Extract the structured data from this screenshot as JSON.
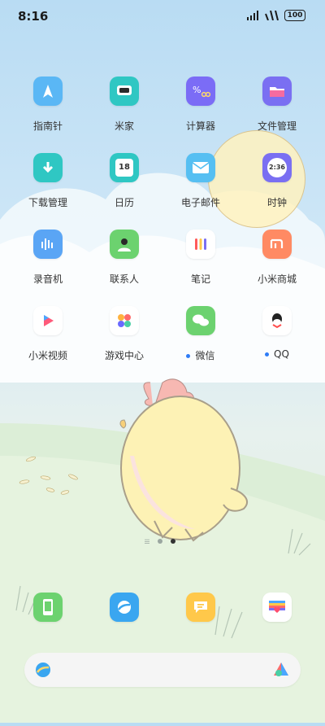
{
  "status": {
    "time": "8:16",
    "battery": "100"
  },
  "apps": [
    {
      "label": "指南针",
      "icon": "compass-icon",
      "color": "#5ab7f5"
    },
    {
      "label": "米家",
      "icon": "mijia-icon",
      "color": "#2fc7c3"
    },
    {
      "label": "计算器",
      "icon": "calculator-icon",
      "color": "#7b6cf6"
    },
    {
      "label": "文件管理",
      "icon": "folder-icon",
      "color": "#7a6ff2"
    },
    {
      "label": "下载管理",
      "icon": "download-icon",
      "color": "#2fc7c3"
    },
    {
      "label": "日历",
      "icon": "calendar-icon",
      "color": "#2fc7c3",
      "badge": "18"
    },
    {
      "label": "电子邮件",
      "icon": "mail-icon",
      "color": "#56bff2"
    },
    {
      "label": "时钟",
      "icon": "clock-icon",
      "color": "#7a6ff2",
      "badge": "2:36"
    },
    {
      "label": "录音机",
      "icon": "recorder-icon",
      "color": "#5aa5f5"
    },
    {
      "label": "联系人",
      "icon": "contacts-icon",
      "color": "#6cd26f"
    },
    {
      "label": "笔记",
      "icon": "notes-icon",
      "color": "#ffffff"
    },
    {
      "label": "小米商城",
      "icon": "mi-store-icon",
      "color": "#ff8a63"
    },
    {
      "label": "小米视频",
      "icon": "video-icon",
      "color": "#ffffff"
    },
    {
      "label": "游戏中心",
      "icon": "game-center-icon",
      "color": "#ffffff"
    },
    {
      "label": "微信",
      "icon": "wechat-icon",
      "color": "#6cd26f",
      "notify": true
    },
    {
      "label": "QQ",
      "icon": "qq-icon",
      "color": "#ffffff",
      "notify": true
    }
  ],
  "dock": [
    {
      "icon": "phone-icon",
      "color": "#6cd26f"
    },
    {
      "icon": "browser-icon",
      "color": "#3aa6f0"
    },
    {
      "icon": "messages-icon",
      "color": "#ffc84a"
    },
    {
      "icon": "gallery-icon",
      "color": "#ffffff"
    }
  ],
  "page_indicator": {
    "pages": 2,
    "current": 2
  }
}
